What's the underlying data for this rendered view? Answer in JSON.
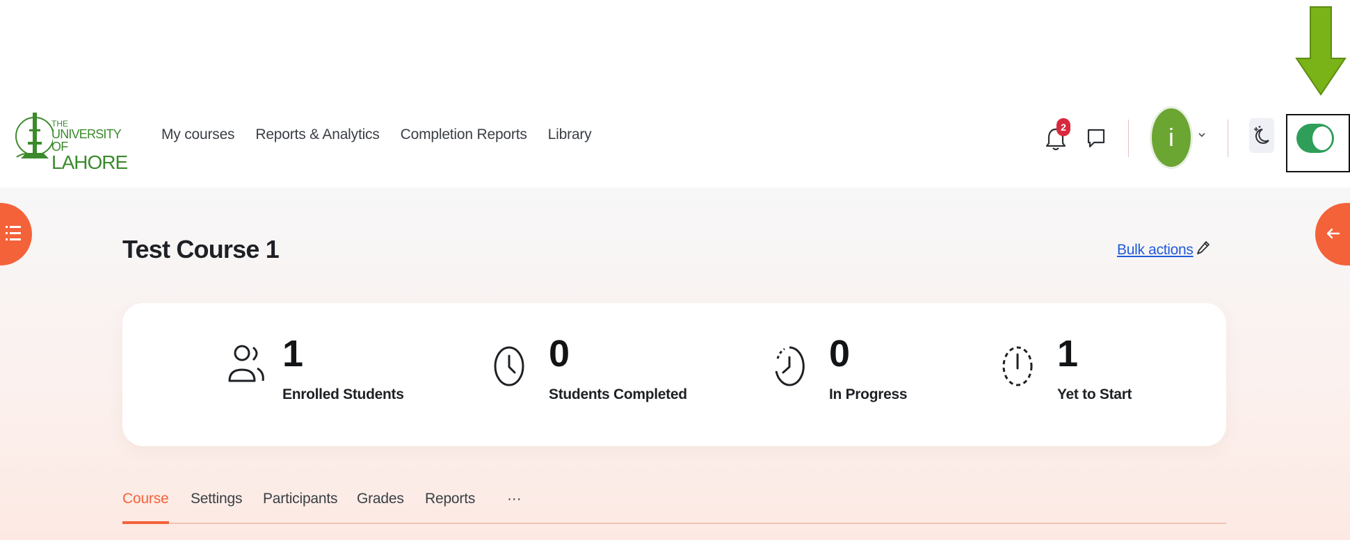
{
  "logo": {
    "line1": "THE",
    "line2": "UNIVERSITY OF",
    "line3": "LAHORE"
  },
  "nav": {
    "links": [
      "My courses",
      "Reports & Analytics",
      "Completion Reports",
      "Library"
    ]
  },
  "header": {
    "notification_count": "2",
    "avatar_initial": "i",
    "toggle_on": true
  },
  "course": {
    "title": "Test Course 1",
    "bulk_actions_label": "Bulk actions"
  },
  "stats": [
    {
      "value": "1",
      "label": "Enrolled Students",
      "icon": "users-icon"
    },
    {
      "value": "0",
      "label": "Students Completed",
      "icon": "clock-icon"
    },
    {
      "value": "0",
      "label": "In Progress",
      "icon": "clock-progress-icon"
    },
    {
      "value": "1",
      "label": "Yet to Start",
      "icon": "timer-dashed-icon"
    }
  ],
  "tabs": [
    {
      "label": "Course",
      "active": true
    },
    {
      "label": "Settings",
      "active": false
    },
    {
      "label": "Participants",
      "active": false
    },
    {
      "label": "Grades",
      "active": false
    },
    {
      "label": "Reports",
      "active": false
    },
    {
      "label": "···",
      "active": false
    }
  ],
  "colors": {
    "accent": "#f4623a",
    "link": "#1f5bd9",
    "toggle": "#2e9e59",
    "avatar": "#6ba532",
    "badge": "#d9293e",
    "annotation_arrow": "#7ab317"
  }
}
